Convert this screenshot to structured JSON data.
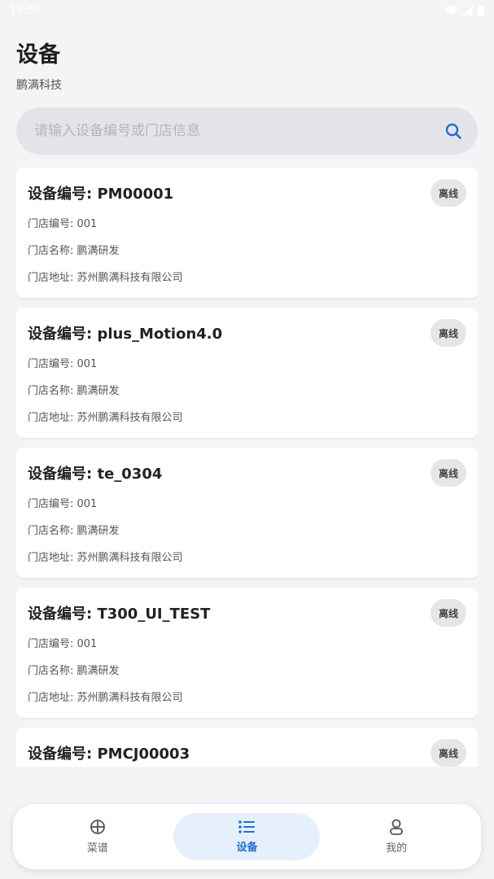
{
  "status_bar": {
    "time": "15:05"
  },
  "header": {
    "title": "设备",
    "subtitle": "鹏满科技"
  },
  "search": {
    "placeholder": "请输入设备编号或门店信息",
    "value": ""
  },
  "devices": [
    {
      "id": "设备编号: PM00001",
      "store_no": "门店编号: 001",
      "store_name": "门店名称: 鹏满研发",
      "store_address": "门店地址: 苏州鹏满科技有限公司",
      "status": "离线"
    },
    {
      "id": "设备编号: plus_Motion4.0",
      "store_no": "门店编号: 001",
      "store_name": "门店名称: 鹏满研发",
      "store_address": "门店地址: 苏州鹏满科技有限公司",
      "status": "离线"
    },
    {
      "id": "设备编号: te_0304",
      "store_no": "门店编号: 001",
      "store_name": "门店名称: 鹏满研发",
      "store_address": "门店地址: 苏州鹏满科技有限公司",
      "status": "离线"
    },
    {
      "id": "设备编号: T300_UI_TEST",
      "store_no": "门店编号: 001",
      "store_name": "门店名称: 鹏满研发",
      "store_address": "门店地址: 苏州鹏满科技有限公司",
      "status": "离线"
    },
    {
      "id": "设备编号: PMCJ00003",
      "status": "离线"
    }
  ],
  "bottom_nav": {
    "items": [
      {
        "label": "菜谱",
        "icon": "circle-plus-icon"
      },
      {
        "label": "设备",
        "icon": "list-icon"
      },
      {
        "label": "我的",
        "icon": "person-icon"
      }
    ],
    "active_index": 1
  },
  "colors": {
    "accent": "#1f6fd6",
    "active_bg": "#e6f0fc",
    "badge_bg": "#e6e6e9"
  }
}
